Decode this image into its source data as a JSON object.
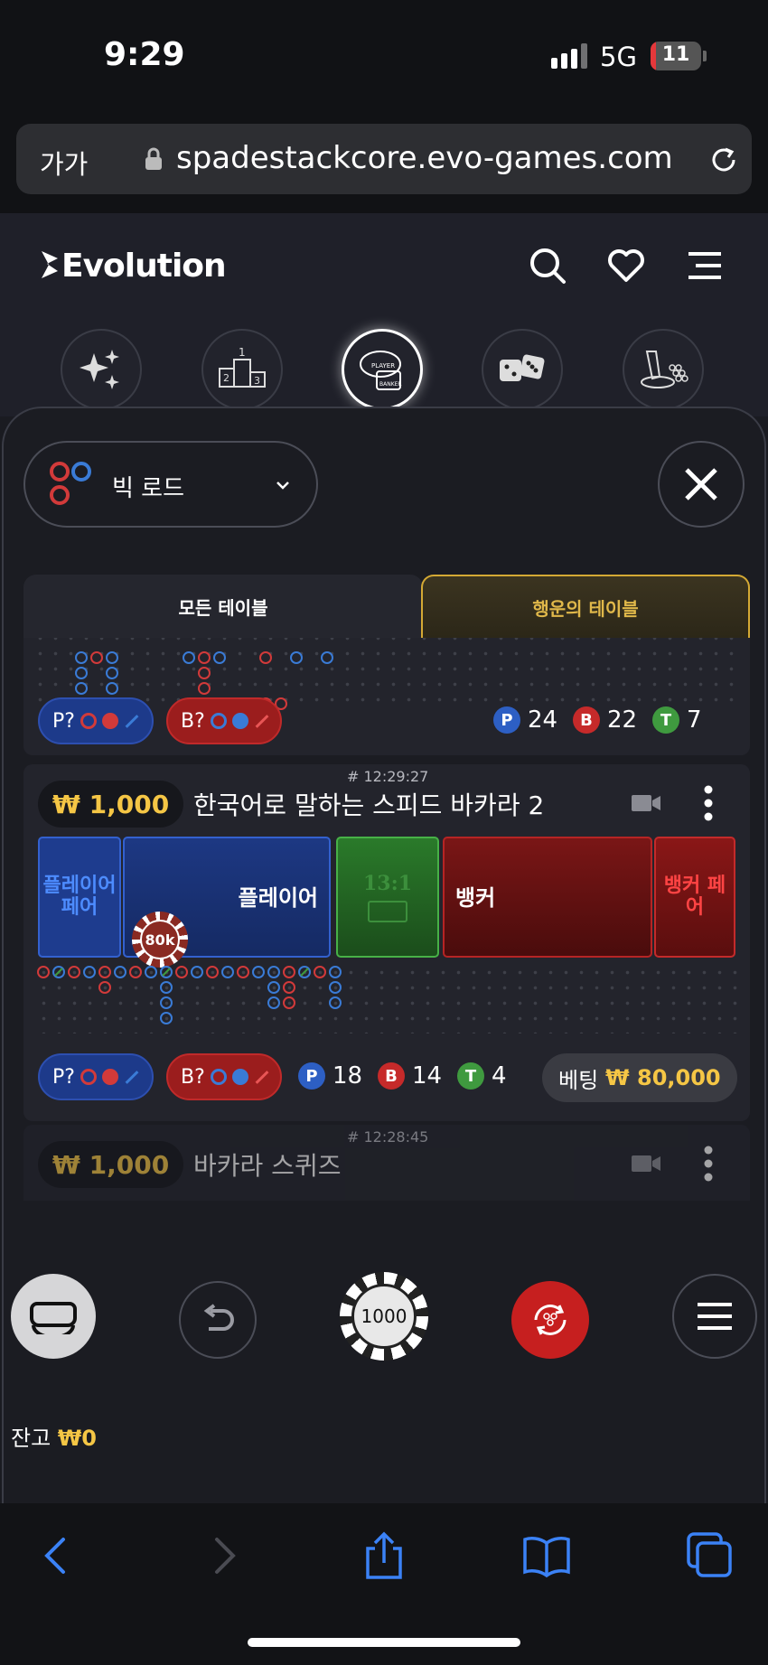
{
  "status_bar": {
    "time": "9:29",
    "network": "5G",
    "battery": "11",
    "battery_level": 0.11
  },
  "browser": {
    "text_size": "가가",
    "url": "spadestackcore.evo-games.com"
  },
  "header": {
    "brand": "Evolution"
  },
  "categories": [
    "sparkles-icon",
    "podium-icon",
    "player-banker-icon",
    "dice-icon",
    "wheel-icon"
  ],
  "road_selector": {
    "label": "빅 로드"
  },
  "tabs": {
    "all": "모든 테이블",
    "lucky": "행운의 테이블"
  },
  "card0": {
    "pill_p": "P?",
    "pill_b": "B?",
    "stats": {
      "p": "24",
      "b": "22",
      "t": "7"
    },
    "stat_letters": {
      "p": "P",
      "b": "B",
      "t": "T"
    }
  },
  "card1": {
    "table_id": "# 12:29:27",
    "min_bet": "₩ 1,000",
    "name": "한국어로 말하는 스피드 바카라 2",
    "zones": {
      "player_pair": "플레이어 페어",
      "player": "플레이어",
      "tie": "13:1",
      "banker": "뱅커",
      "banker_pair": "뱅커 페어"
    },
    "chip_on_player": "80k",
    "pill_p": "P?",
    "pill_b": "B?",
    "stats": {
      "p": "18",
      "b": "14",
      "t": "4"
    },
    "stat_letters": {
      "p": "P",
      "b": "B",
      "t": "T"
    },
    "bet_label": "베팅",
    "bet_amount": "₩ 80,000"
  },
  "card2": {
    "table_id": "# 12:28:45",
    "min_bet": "₩ 1,000",
    "name": "바카라 스퀴즈"
  },
  "controls": {
    "chip_value": "1000"
  },
  "balance": {
    "label": "잔고",
    "amount": "₩0"
  },
  "colors": {
    "accent_gold": "#f5c645",
    "player_blue": "#1d3a8a",
    "banker_red": "#9b1d1d",
    "tie_green": "#2a7a2a"
  }
}
